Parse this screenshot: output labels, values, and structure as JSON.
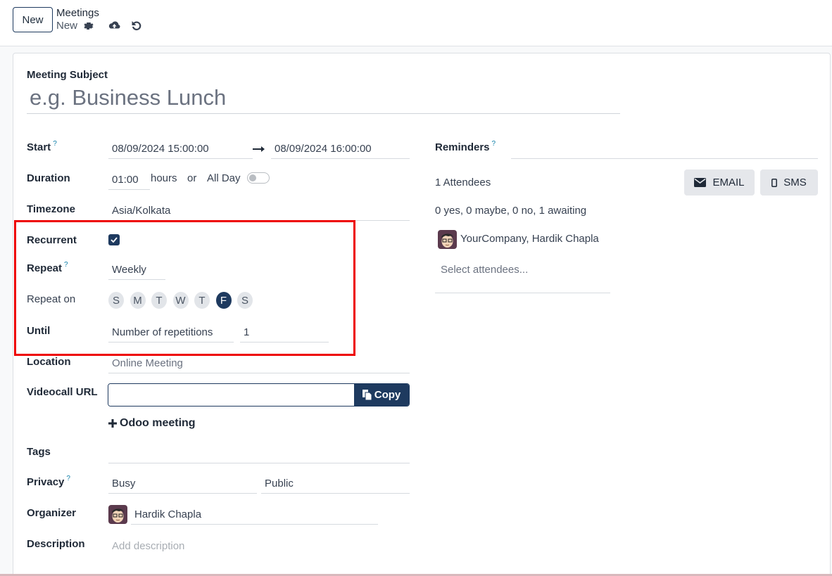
{
  "control_panel": {
    "new_button_label": "New",
    "breadcrumb_parent": "Meetings",
    "breadcrumb_current": "New",
    "icons": [
      "gear-icon",
      "cloud-upload-icon",
      "undo-icon"
    ]
  },
  "form": {
    "subject_label": "Meeting Subject",
    "subject_placeholder": "e.g. Business Lunch",
    "start": {
      "label": "Start",
      "help": "?",
      "start_value": "08/09/2024 15:00:00",
      "end_value": "08/09/2024 16:00:00"
    },
    "duration": {
      "label": "Duration",
      "value": "01:00",
      "hours_text": "hours",
      "or_text": "or",
      "all_day_label": "All Day",
      "all_day_on": false
    },
    "timezone": {
      "label": "Timezone",
      "value": "Asia/Kolkata"
    },
    "recurrent": {
      "label": "Recurrent",
      "checked": true
    },
    "repeat": {
      "label": "Repeat",
      "help": "?",
      "value": "Weekly"
    },
    "repeat_on": {
      "label": "Repeat on",
      "days": [
        {
          "label": "S",
          "active": false
        },
        {
          "label": "M",
          "active": false
        },
        {
          "label": "T",
          "active": false
        },
        {
          "label": "W",
          "active": false
        },
        {
          "label": "T",
          "active": false
        },
        {
          "label": "F",
          "active": true
        },
        {
          "label": "S",
          "active": false
        }
      ]
    },
    "until": {
      "label": "Until",
      "type_value": "Number of repetitions",
      "count_value": "1"
    },
    "location": {
      "label": "Location",
      "placeholder": "Online Meeting"
    },
    "videocall": {
      "label": "Videocall URL",
      "value": "",
      "copy_label": "Copy",
      "odoo_meeting_label": "Odoo meeting"
    },
    "tags": {
      "label": "Tags"
    },
    "privacy": {
      "label": "Privacy",
      "help": "?",
      "show_as": "Busy",
      "privacy_value": "Public"
    },
    "organizer": {
      "label": "Organizer",
      "value": "Hardik Chapla"
    },
    "description": {
      "label": "Description",
      "placeholder": "Add description"
    }
  },
  "right_panel": {
    "reminders": {
      "label": "Reminders",
      "help": "?"
    },
    "attendees_count": "1 Attendees",
    "email_button": "EMAIL",
    "sms_button": "SMS",
    "attendance_summary": "0 yes, 0 maybe, 0 no, 1 awaiting",
    "attendee_name": "YourCompany, Hardik Chapla",
    "select_attendees_placeholder": "Select attendees..."
  },
  "colors": {
    "brand": "#1e3a5f",
    "highlight_box": "#ee0000",
    "help_mark": "#0d7ea8"
  }
}
